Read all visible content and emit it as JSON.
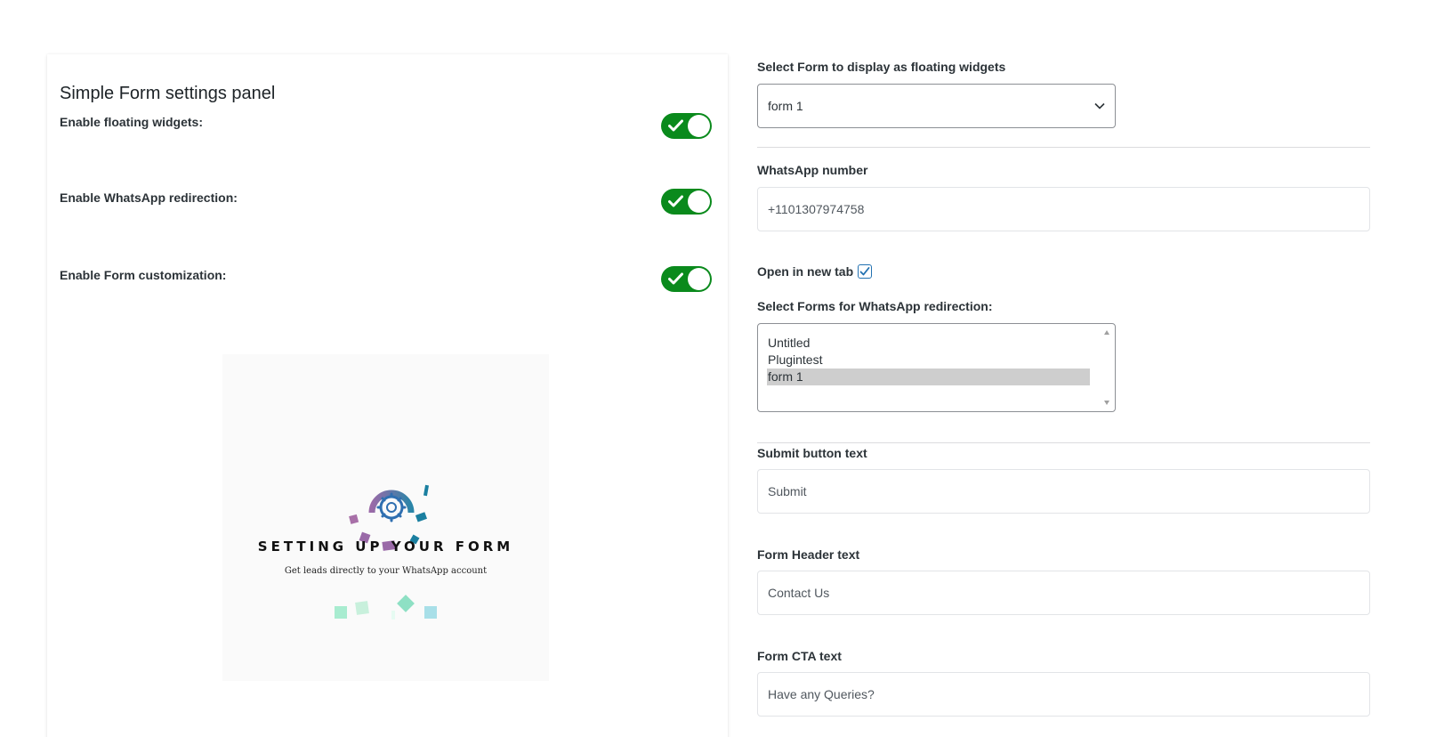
{
  "panel": {
    "title": "Simple Form settings panel",
    "toggles": [
      {
        "label": "Enable floating widgets:",
        "state": "on"
      },
      {
        "label": "Enable WhatsApp redirection:",
        "state": "on"
      },
      {
        "label": "Enable Form customization:",
        "state": "on"
      }
    ],
    "hero": {
      "title": "SETTING UP YOUR FORM",
      "subtitle": "Get leads directly to your WhatsApp account"
    }
  },
  "settings": {
    "floating_form_label": "Select Form to display as floating widgets",
    "floating_form_value": "form 1",
    "whatsapp_label": "WhatsApp number",
    "whatsapp_value": "+1101307974758",
    "new_tab_label": "Open in new tab",
    "new_tab_checked": true,
    "redirect_forms_label": "Select Forms for WhatsApp redirection:",
    "redirect_forms": [
      {
        "label": "Untitled",
        "selected": false
      },
      {
        "label": "Plugintest",
        "selected": false
      },
      {
        "label": "form 1",
        "selected": true
      }
    ],
    "submit_label": "Submit button text",
    "submit_value": "Submit",
    "header_label": "Form Header text",
    "header_value": "Contact Us",
    "cta_label": "Form CTA text",
    "cta_value": "Have any Queries?"
  },
  "colors": {
    "toggle_on": "#0a8a1c",
    "checkbox_accent": "#2271b1"
  }
}
